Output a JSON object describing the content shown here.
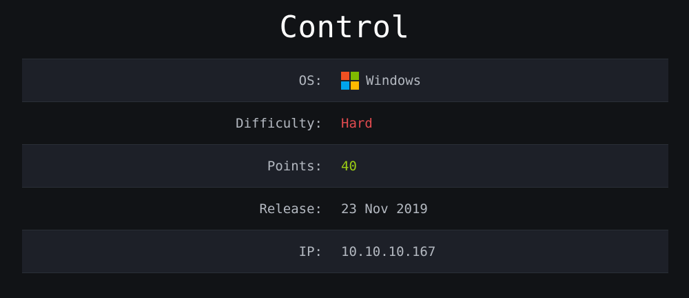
{
  "page": {
    "title": "Control"
  },
  "info": {
    "os": {
      "label": "OS:",
      "value": "Windows",
      "icon": "windows-logo-icon"
    },
    "difficulty": {
      "label": "Difficulty:",
      "value": "Hard",
      "color": "#e24b4f"
    },
    "points": {
      "label": "Points:",
      "value": "40",
      "color": "#9acc14"
    },
    "release": {
      "label": "Release:",
      "value": "23 Nov 2019"
    },
    "ip": {
      "label": "IP:",
      "value": "10.10.10.167"
    }
  }
}
